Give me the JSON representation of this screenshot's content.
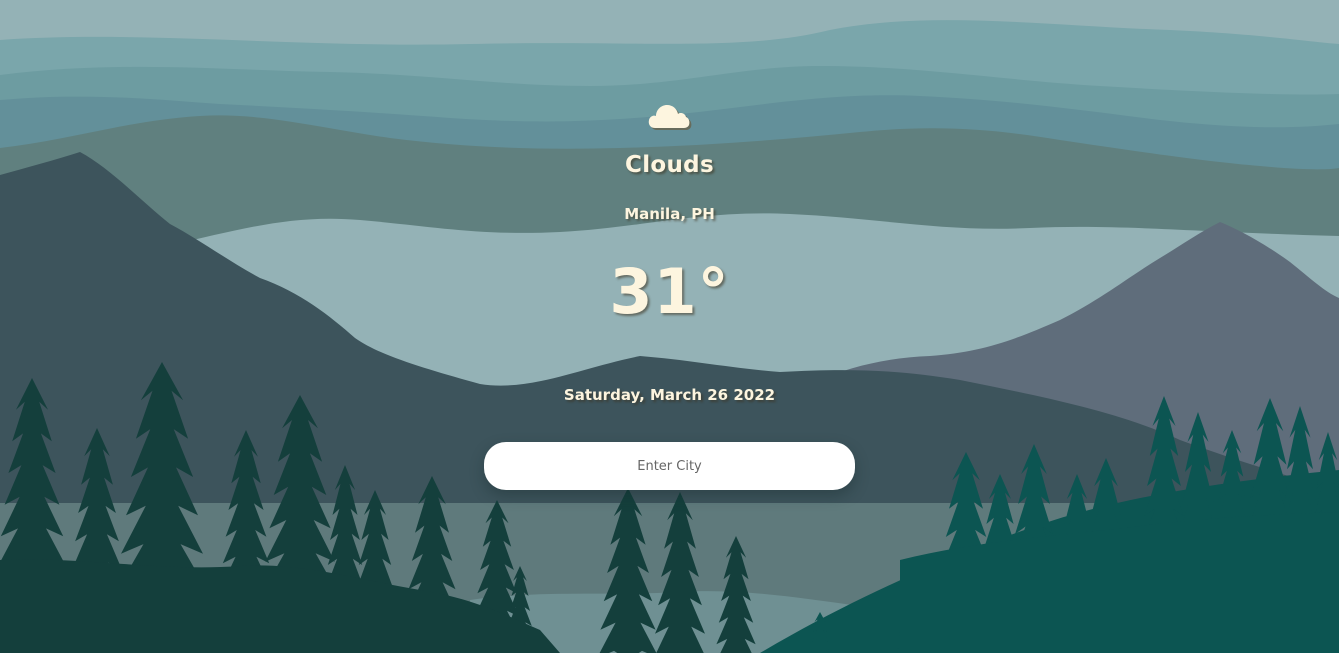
{
  "weather": {
    "condition": "Clouds",
    "location": "Manila, PH",
    "temperature": "31°",
    "date": "Saturday, March 26 2022",
    "icon": "cloud-icon"
  },
  "search": {
    "placeholder": "Enter City",
    "value": ""
  },
  "colors": {
    "sky": "#94b2b6",
    "text": "#fdf5df",
    "forest_dark": "#143f3c",
    "forest_teal": "#0c5552",
    "mountain_slate": "#3d545c",
    "mountain_purple": "#5f6d7b"
  }
}
